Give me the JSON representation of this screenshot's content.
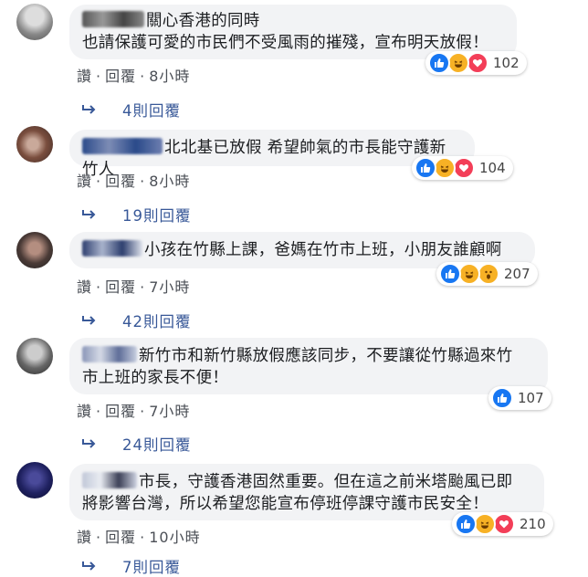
{
  "comments": [
    {
      "text_lines": [
        "關心香港的同時",
        "也請保護可愛的市民們不受風雨的摧殘，宣布明天放假！"
      ],
      "reaction_count": "102",
      "like_label": "讚",
      "reply_label": "回覆",
      "time": "8小時",
      "replies_label": "4則回覆"
    },
    {
      "text_lines": [
        "北北基已放假 希望帥氣的市長能守護新竹人"
      ],
      "reaction_count": "104",
      "like_label": "讚",
      "reply_label": "回覆",
      "time": "8小時",
      "replies_label": "19則回覆"
    },
    {
      "text_lines": [
        "小孩在竹縣上課，爸媽在竹市上班，小朋友誰顧啊"
      ],
      "reaction_count": "207",
      "like_label": "讚",
      "reply_label": "回覆",
      "time": "7小時",
      "replies_label": "42則回覆"
    },
    {
      "text_lines": [
        "新竹市和新竹縣放假應該同步，不要讓從竹縣過來竹",
        "市上班的家長不便！"
      ],
      "reaction_count": "107",
      "like_label": "讚",
      "reply_label": "回覆",
      "time": "7小時",
      "replies_label": "24則回覆"
    },
    {
      "text_lines": [
        "市長，守護香港固然重要。但在這之前米塔颱風已即",
        "將影響台灣，所以希望您能宣布停班停課守護市民安全！"
      ],
      "reaction_count": "210",
      "like_label": "讚",
      "reply_label": "回覆",
      "time": "10小時",
      "replies_label": "7則回覆"
    }
  ],
  "icons": {
    "like": "like-reaction-icon",
    "haha": "haha-reaction-icon",
    "love": "love-reaction-icon",
    "wow": "wow-reaction-icon",
    "reply_arrow": "reply-arrow-icon"
  },
  "colors": {
    "bubble_bg": "#f2f3f5",
    "link": "#385898",
    "like_blue": "#1877f2",
    "love_red": "#f33e58",
    "haha_yellow": "#f7b125"
  }
}
